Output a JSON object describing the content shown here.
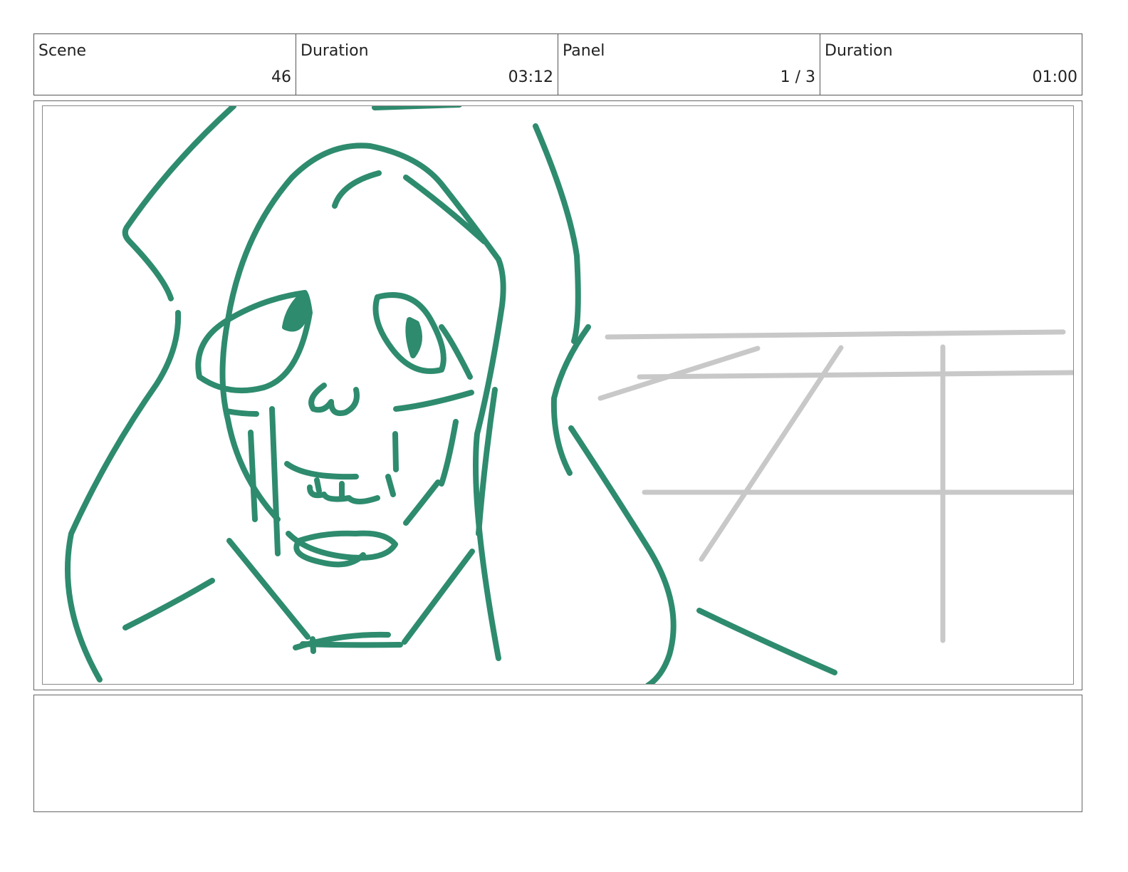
{
  "header": {
    "scene": {
      "label": "Scene",
      "value": "46"
    },
    "scene_duration": {
      "label": "Duration",
      "value": "03:12"
    },
    "panel": {
      "label": "Panel",
      "value": "1 / 3"
    },
    "panel_duration": {
      "label": "Duration",
      "value": "01:00"
    }
  },
  "sketch": {
    "stroke_color": "#2e8b6e",
    "guide_color": "#c8c8c8"
  },
  "notes": {
    "text": ""
  }
}
